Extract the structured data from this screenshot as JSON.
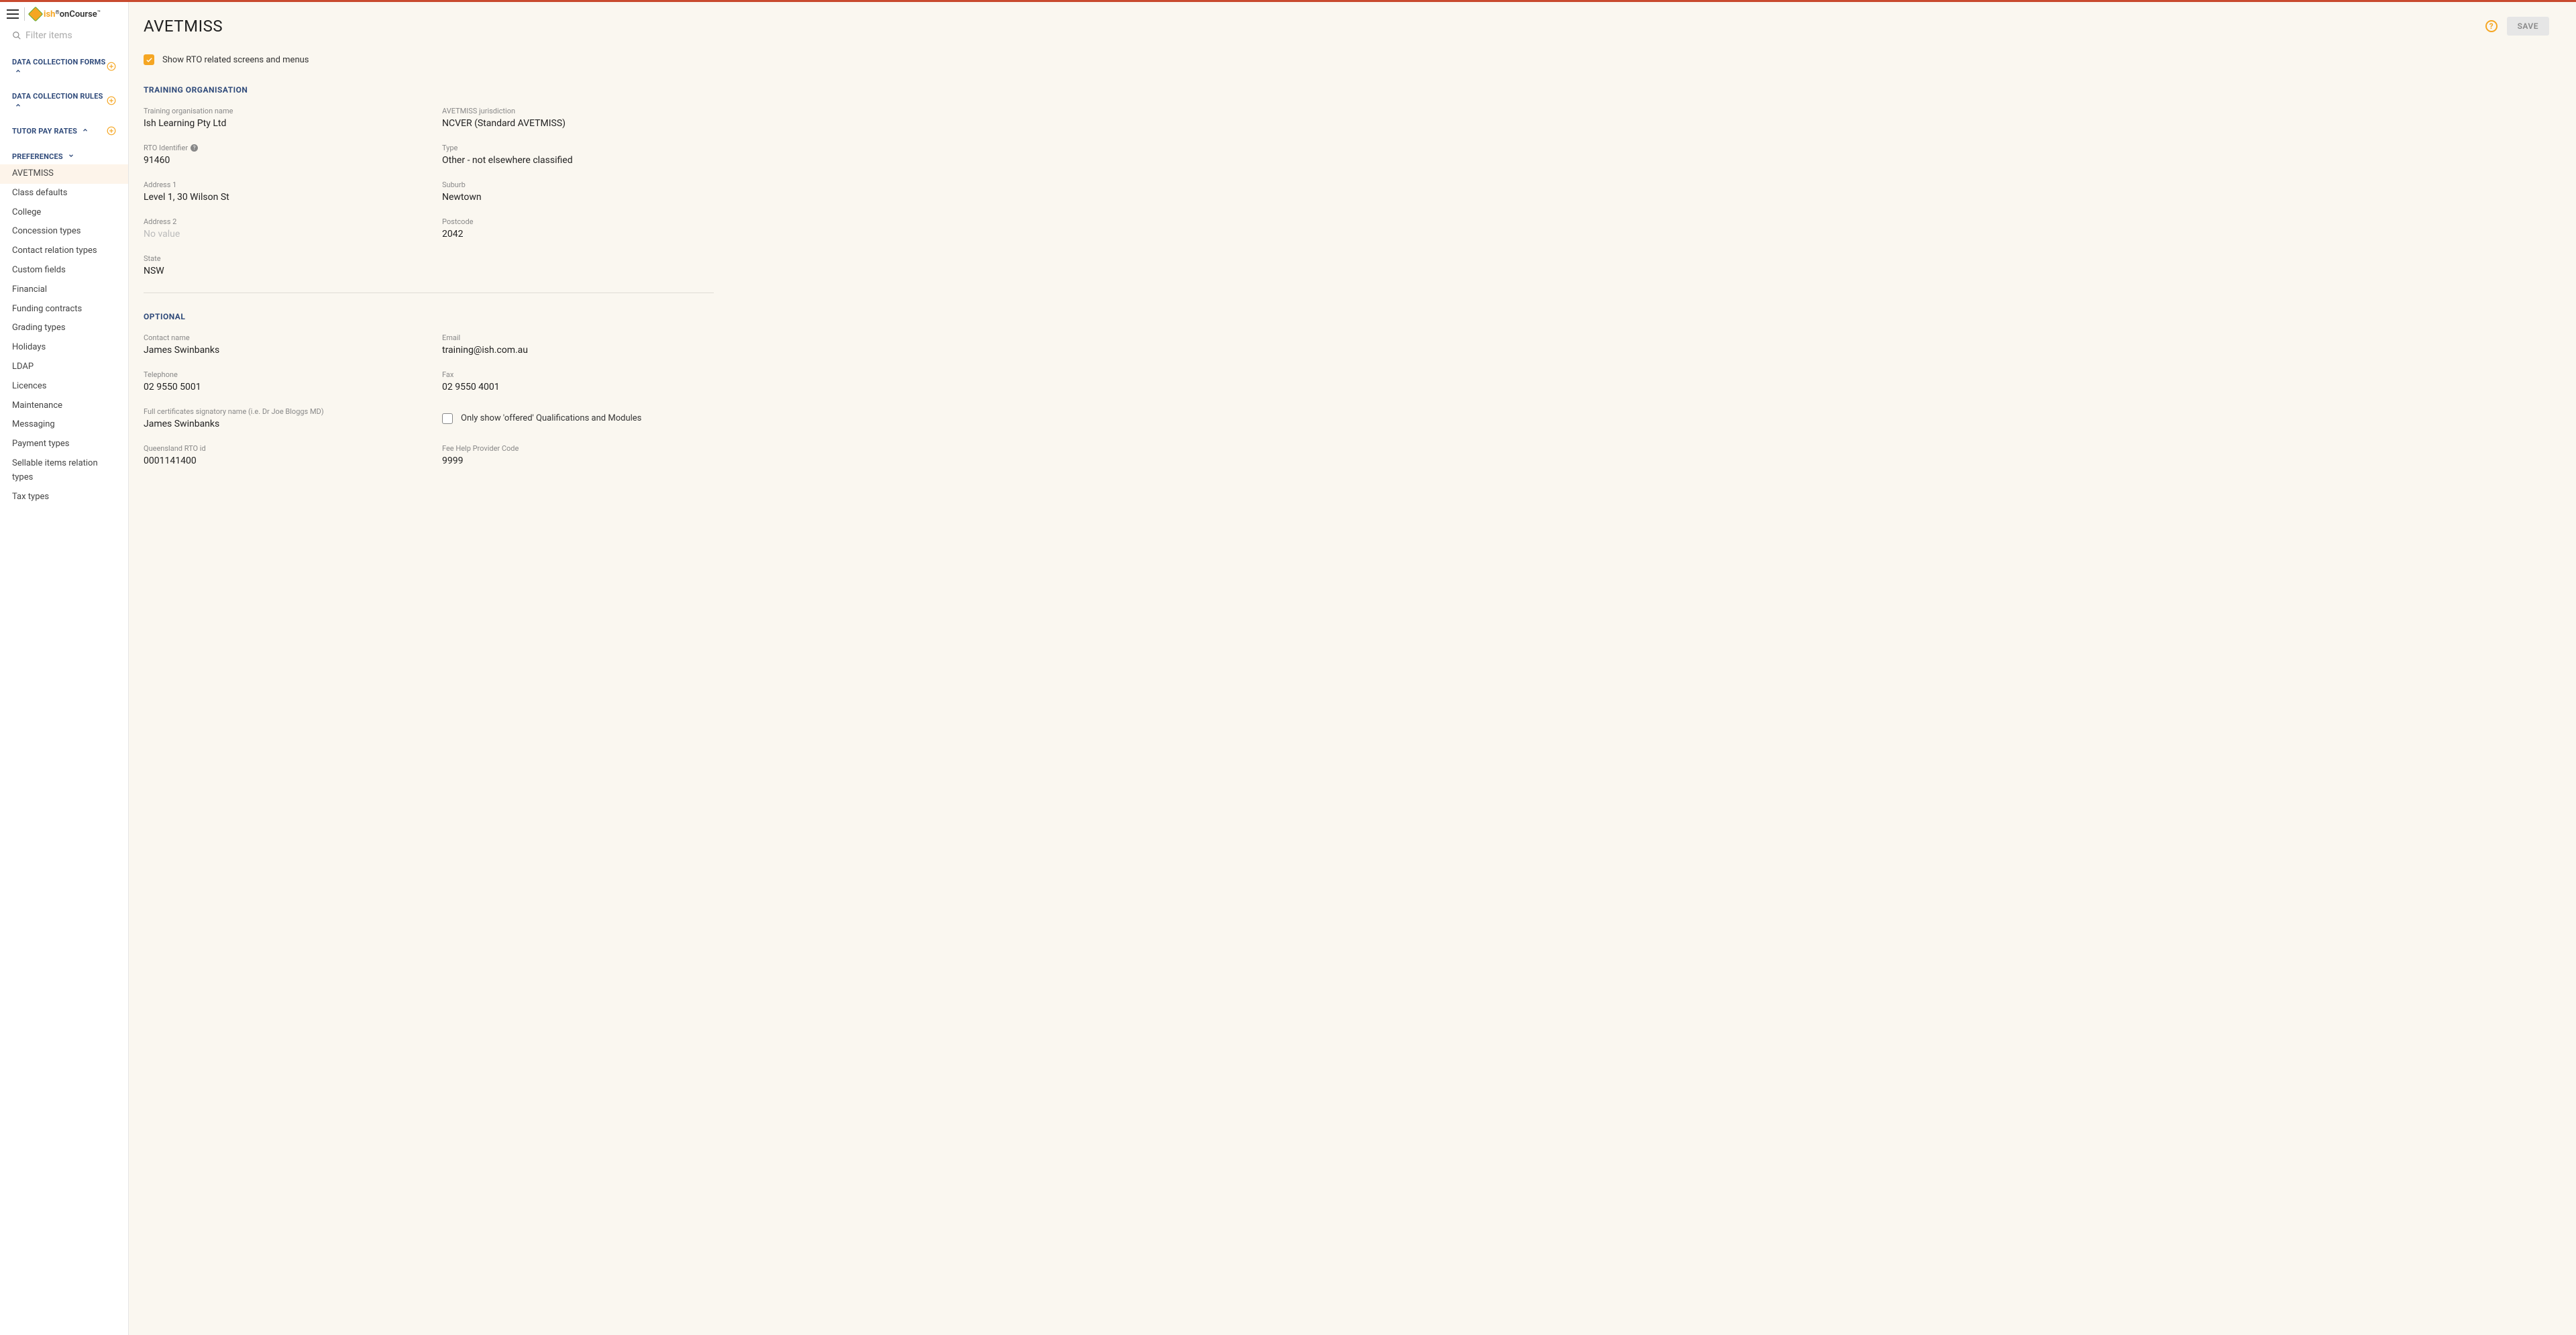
{
  "brand": {
    "ish": "ish",
    "oncourse": "onCourse",
    "reg_mark": "®"
  },
  "search": {
    "placeholder": "Filter items"
  },
  "sidebar": {
    "groups": [
      {
        "title": "DATA COLLECTION FORMS",
        "expanded": false,
        "add": true
      },
      {
        "title": "DATA COLLECTION RULES",
        "expanded": false,
        "add": true
      },
      {
        "title": "TUTOR PAY RATES",
        "expanded": false,
        "add": true
      },
      {
        "title": "PREFERENCES",
        "expanded": true,
        "add": false
      }
    ],
    "prefs": [
      "AVETMISS",
      "Class defaults",
      "College",
      "Concession types",
      "Contact relation types",
      "Custom fields",
      "Financial",
      "Funding contracts",
      "Grading types",
      "Holidays",
      "LDAP",
      "Licences",
      "Maintenance",
      "Messaging",
      "Payment types",
      "Sellable items relation types",
      "Tax types"
    ],
    "active_index": 0
  },
  "header": {
    "title": "AVETMISS",
    "save": "SAVE",
    "help": "?"
  },
  "show_rto": {
    "checked": true,
    "label": "Show RTO related screens and menus"
  },
  "sections": {
    "training_org": {
      "title": "TRAINING ORGANISATION",
      "fields": {
        "org_name": {
          "label": "Training organisation name",
          "value": "Ish Learning Pty Ltd"
        },
        "jurisdiction": {
          "label": "AVETMISS jurisdiction",
          "value": "NCVER (Standard AVETMISS)"
        },
        "rto_id": {
          "label": "RTO Identifier",
          "value": "91460",
          "info": true
        },
        "type": {
          "label": "Type",
          "value": "Other - not elsewhere classified"
        },
        "address1": {
          "label": "Address 1",
          "value": "Level 1, 30 Wilson St"
        },
        "suburb": {
          "label": "Suburb",
          "value": "Newtown"
        },
        "address2": {
          "label": "Address 2",
          "value": "No value",
          "placeholder": true
        },
        "postcode": {
          "label": "Postcode",
          "value": "2042"
        },
        "state": {
          "label": "State",
          "value": "NSW"
        }
      }
    },
    "optional": {
      "title": "OPTIONAL",
      "fields": {
        "contact_name": {
          "label": "Contact name",
          "value": "James Swinbanks"
        },
        "email": {
          "label": "Email",
          "value": "training@ish.com.au"
        },
        "telephone": {
          "label": "Telephone",
          "value": "02 9550 5001"
        },
        "fax": {
          "label": "Fax",
          "value": "02 9550 4001"
        },
        "signatory": {
          "label": "Full certificates signatory name (i.e. Dr Joe Bloggs MD)",
          "value": "James Swinbanks"
        },
        "only_offered": {
          "label": "Only show 'offered' Qualifications and Modules",
          "checked": false
        },
        "qld_rto": {
          "label": "Queensland RTO id",
          "value": "0001141400"
        },
        "fee_help": {
          "label": "Fee Help Provider Code",
          "value": "9999"
        }
      }
    }
  }
}
